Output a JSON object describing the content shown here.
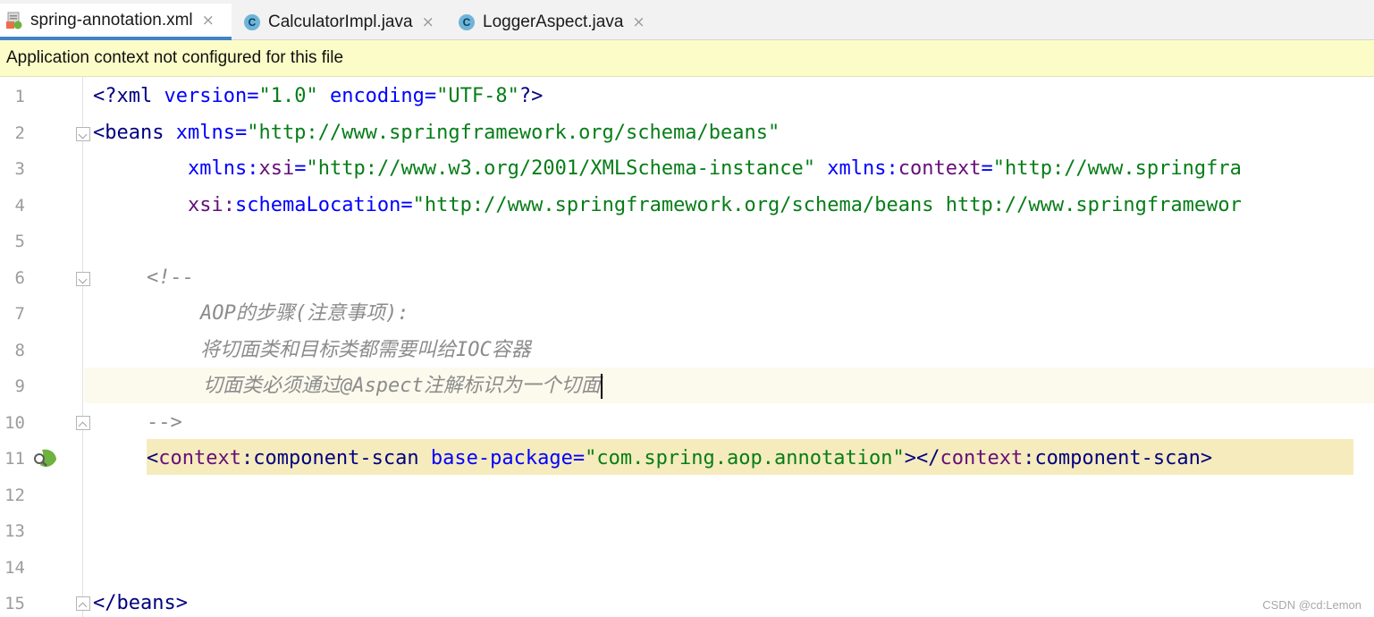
{
  "tabs": [
    {
      "label": "spring-annotation.xml",
      "icon": "xml-file-icon",
      "active": true
    },
    {
      "label": "CalculatorImpl.java",
      "icon": "java-class-icon",
      "icon_letter": "C",
      "active": false
    },
    {
      "label": "LoggerAspect.java",
      "icon": "java-class-icon",
      "icon_letter": "C",
      "active": false
    }
  ],
  "close_glyph": "×",
  "banner": {
    "text": "Application context not configured for this file"
  },
  "line_numbers": [
    "1",
    "2",
    "3",
    "4",
    "5",
    "6",
    "7",
    "8",
    "9",
    "10",
    "11",
    "12",
    "13",
    "14",
    "15"
  ],
  "code": {
    "l1": {
      "open": "<?",
      "name": "xml",
      "a1": " version=",
      "v1": "\"1.0\"",
      "a2": " encoding=",
      "v2": "\"UTF-8\"",
      "close": "?>"
    },
    "l2": {
      "open": "<",
      "name": "beans",
      "attr": " xmlns=",
      "val": "\"http://www.springframework.org/schema/beans\""
    },
    "l3": {
      "ns1": "xmlns:",
      "a1": "xsi",
      "eq1": "=",
      "v1": "\"http://www.w3.org/2001/XMLSchema-instance\"",
      "ns2": " xmlns:",
      "a2": "context",
      "eq2": "=",
      "v2": "\"http://www.springfra"
    },
    "l4": {
      "ns": "xsi:",
      "attr": "schemaLocation",
      "eq": "=",
      "val": "\"http://www.springframework.org/schema/beans http://www.springframewor"
    },
    "l6": "<!--",
    "l7": "AOP的步骤(注意事项):",
    "l8": "将切面类和目标类都需要叫给IOC容器",
    "l9": "切面类必须通过@Aspect注解标识为一个切面",
    "l10": "-->",
    "l11": {
      "open": "<",
      "ns1": "context",
      "colon1": ":",
      "name1": "component-scan",
      "attr": " base-package",
      "eq": "=",
      "val": "\"com.spring.aop.annotation\"",
      "mid": "></",
      "ns2": "context",
      "colon2": ":",
      "name2": "component-scan",
      "close": ">"
    },
    "l15": {
      "open": "</",
      "name": "beans",
      "close": ">"
    }
  },
  "colors": {
    "accent": "#4083c9",
    "banner_bg": "#fcfcc8",
    "tag": "#000080",
    "attribute": "#0000ff",
    "namespace": "#660e7a",
    "string": "#067d17",
    "comment": "#8c8c8c"
  },
  "watermark": "CSDN @cd:Lemon"
}
